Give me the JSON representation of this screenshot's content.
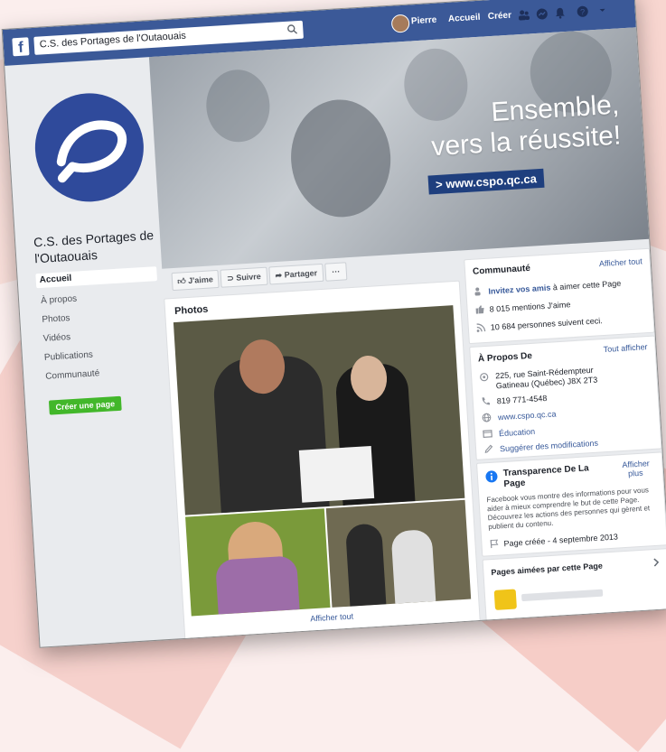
{
  "search": {
    "value": "C.S. des Portages de l'Outaouais"
  },
  "topnav": {
    "user": "Pierre",
    "home": "Accueil",
    "create": "Créer"
  },
  "page": {
    "name": "C.S. des Portages de l'Outaouais"
  },
  "sidebar": {
    "items": [
      {
        "label": "Accueil"
      },
      {
        "label": "À propos"
      },
      {
        "label": "Photos"
      },
      {
        "label": "Vidéos"
      },
      {
        "label": "Publications"
      },
      {
        "label": "Communauté"
      }
    ],
    "create_page": "Créer une page"
  },
  "cover": {
    "line1": "Ensemble,",
    "line2": "vers la réussite!",
    "url": "> www.cspo.qc.ca"
  },
  "actions": {
    "like": "J'aime",
    "follow": "Suivre",
    "share": "Partager",
    "more": "···"
  },
  "photos": {
    "title": "Photos",
    "see_all": "Afficher tout"
  },
  "community": {
    "title": "Communauté",
    "see_all": "Afficher tout",
    "invite_link": "Invitez vos amis",
    "invite_rest": " à aimer cette Page",
    "likes": "8 015 mentions J'aime",
    "follows": "10 684 personnes suivent ceci."
  },
  "about": {
    "title": "À Propos De",
    "see_all": "Tout afficher",
    "address1": "225, rue Saint-Rédempteur",
    "address2": "Gatineau (Québec) J8X 2T3",
    "phone": "819 771-4548",
    "website": "www.cspo.qc.ca",
    "category": "Éducation",
    "suggest": "Suggérer des modifications"
  },
  "transparency": {
    "title1": "Transparence De La",
    "title2": "Page",
    "see_more1": "Afficher",
    "see_more2": "plus",
    "desc1": "Facebook vous montre des informations pour vous",
    "desc2": "aider à mieux comprendre le but de cette Page.",
    "desc3": "Découvrez les actions des personnes qui gèrent et",
    "desc4": "publient du contenu.",
    "created": "Page créée - 4 septembre 2013"
  },
  "liked_pages": {
    "title": "Pages aimées par cette Page"
  },
  "colors": {
    "brand": "#3b5998",
    "green": "#42b72a",
    "link": "#365899"
  }
}
